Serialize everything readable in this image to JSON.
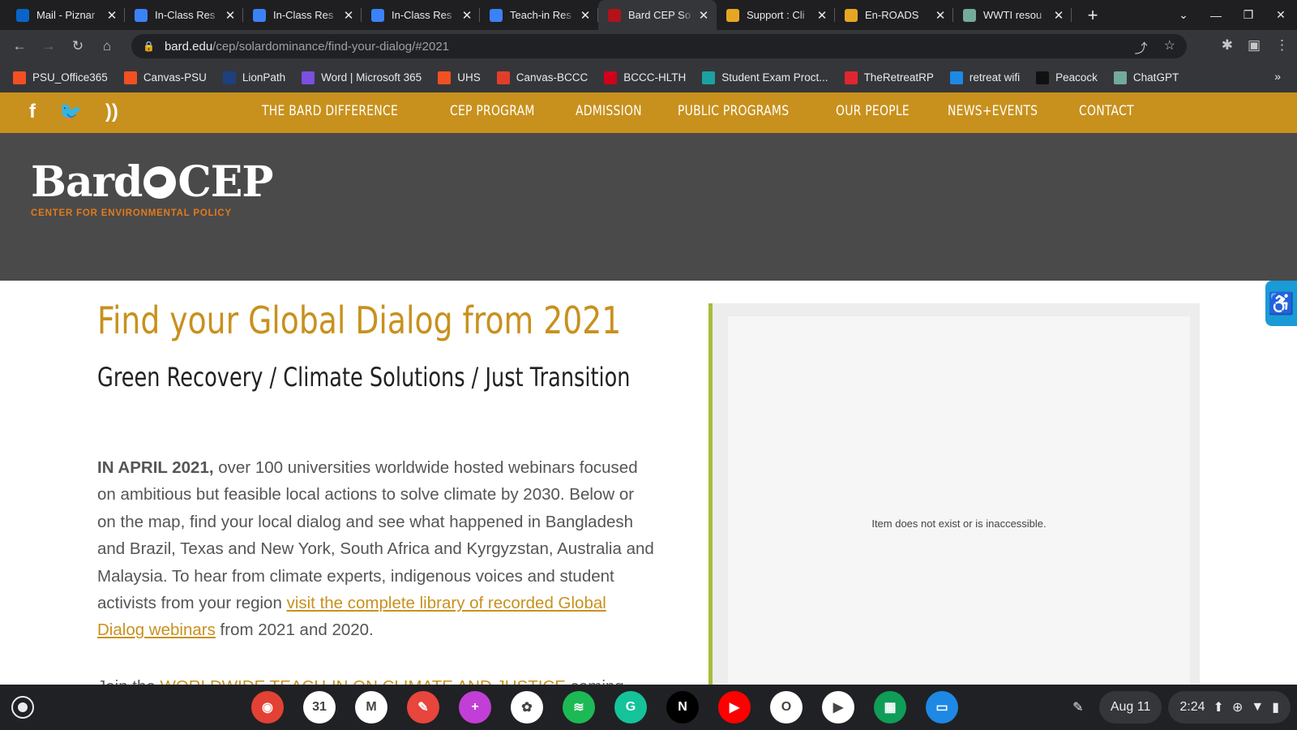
{
  "browser": {
    "tabs": [
      {
        "title": "Mail - Piznar",
        "icon": "outlook-icon",
        "color": "#0a64c8"
      },
      {
        "title": "In-Class Res",
        "icon": "docs-icon",
        "color": "#3b82f6"
      },
      {
        "title": "In-Class Res",
        "icon": "docs-icon",
        "color": "#3b82f6"
      },
      {
        "title": "In-Class Res",
        "icon": "docs-icon",
        "color": "#3b82f6"
      },
      {
        "title": "Teach-in Res",
        "icon": "docs-icon",
        "color": "#3b82f6"
      },
      {
        "title": "Bard CEP So",
        "icon": "bard-icon",
        "color": "#b3121b",
        "active": true
      },
      {
        "title": "Support : Cli",
        "icon": "loading-icon",
        "color": "#e6a623"
      },
      {
        "title": "En-ROADS",
        "icon": "loading-icon",
        "color": "#e6a623"
      },
      {
        "title": "WWTI resou",
        "icon": "chatgpt-icon",
        "color": "#74aa9c"
      }
    ],
    "url_host": "bard.edu",
    "url_path": "/cep/solardominance/find-your-dialog/#2021",
    "bookmarks": [
      {
        "label": "PSU_Office365",
        "icon": "microsoft-icon",
        "color": "#f25022"
      },
      {
        "label": "Canvas-PSU",
        "icon": "microsoft-icon",
        "color": "#f25022"
      },
      {
        "label": "LionPath",
        "icon": "lionpath-icon",
        "color": "#1e407c"
      },
      {
        "label": "Word | Microsoft 365",
        "icon": "m365-icon",
        "color": "#7b4fe0"
      },
      {
        "label": "UHS",
        "icon": "microsoft-icon",
        "color": "#f25022"
      },
      {
        "label": "Canvas-BCCC",
        "icon": "canvas-icon",
        "color": "#e13e2a"
      },
      {
        "label": "BCCC-HLTH",
        "icon": "mcgraw-icon",
        "color": "#d0021b"
      },
      {
        "label": "Student Exam Proct...",
        "icon": "proctor-icon",
        "color": "#1ba1a1"
      },
      {
        "label": "TheRetreatRP",
        "icon": "rp-icon",
        "color": "#e0262f"
      },
      {
        "label": "retreat wifi",
        "icon": "wifi-bookmark-icon",
        "color": "#1e88e5"
      },
      {
        "label": "Peacock",
        "icon": "peacock-icon",
        "color": "#111111"
      },
      {
        "label": "ChatGPT",
        "icon": "chatgpt-icon",
        "color": "#74aa9c"
      }
    ],
    "bookmarks_more": "»"
  },
  "site": {
    "nav": [
      "THE BARD DIFFERENCE",
      "CEP PROGRAM",
      "ADMISSION",
      "PUBLIC PROGRAMS",
      "OUR PEOPLE",
      "NEWS+EVENTS",
      "CONTACT"
    ],
    "logo_wordmark_left": "Bard",
    "logo_wordmark_right": "CEP",
    "logo_sub": "CENTER FOR ENVIRONMENTAL POLICY",
    "title": "Find your Global Dialog from 2021",
    "subtitle": "Green Recovery / Climate Solutions / Just Transition",
    "lead_bold": "IN APRIL 2021,",
    "lead_text": " over 100 universities worldwide hosted webinars focused on ambitious but feasible local actions to solve climate by 2030. Below or on the map, find your local dialog and see what happened in Bangladesh and Brazil, Texas and New York, South Africa and Kyrgyzstan, Australia and Malaysia.  To hear from climate experts, indigenous voices and student activists from your region ",
    "lead_link": "visit the complete library of recorded Global Dialog webinars",
    "lead_tail": " from 2021 and 2020.",
    "next_prefix": "Join the ",
    "next_link": "WORLDWIDE TEACH-IN ON CLIMATE AND JUSTICE",
    "next_suffix": " coming",
    "embed_message": "Item does not exist or is inaccessible.",
    "accent": "#c8911d",
    "band_color": "#4a4a4a"
  },
  "shelf": {
    "apps": [
      {
        "name": "chrome-icon",
        "color": "#e34133",
        "glyph": "◉"
      },
      {
        "name": "calendar-icon",
        "color": "#ffffff",
        "glyph": "31"
      },
      {
        "name": "gmail-icon",
        "color": "#ffffff",
        "glyph": "M"
      },
      {
        "name": "paint-icon",
        "color": "#e8453c",
        "glyph": "✎"
      },
      {
        "name": "canvas-app-icon",
        "color": "#c13fd6",
        "glyph": "+"
      },
      {
        "name": "photos-icon",
        "color": "#ffffff",
        "glyph": "✿"
      },
      {
        "name": "spotify-icon",
        "color": "#1db954",
        "glyph": "≋"
      },
      {
        "name": "grammarly-icon",
        "color": "#15c39a",
        "glyph": "G"
      },
      {
        "name": "netflix-icon",
        "color": "#000000",
        "glyph": "N"
      },
      {
        "name": "youtube-icon",
        "color": "#ff0000",
        "glyph": "▶"
      },
      {
        "name": "office-icon",
        "color": "#ffffff",
        "glyph": "O"
      },
      {
        "name": "play-store-icon",
        "color": "#ffffff",
        "glyph": "▶"
      },
      {
        "name": "sheets-icon",
        "color": "#0f9d58",
        "glyph": "▦"
      },
      {
        "name": "files-icon",
        "color": "#1e88e5",
        "glyph": "▭"
      }
    ],
    "date": "Aug 11",
    "time": "2:24"
  }
}
